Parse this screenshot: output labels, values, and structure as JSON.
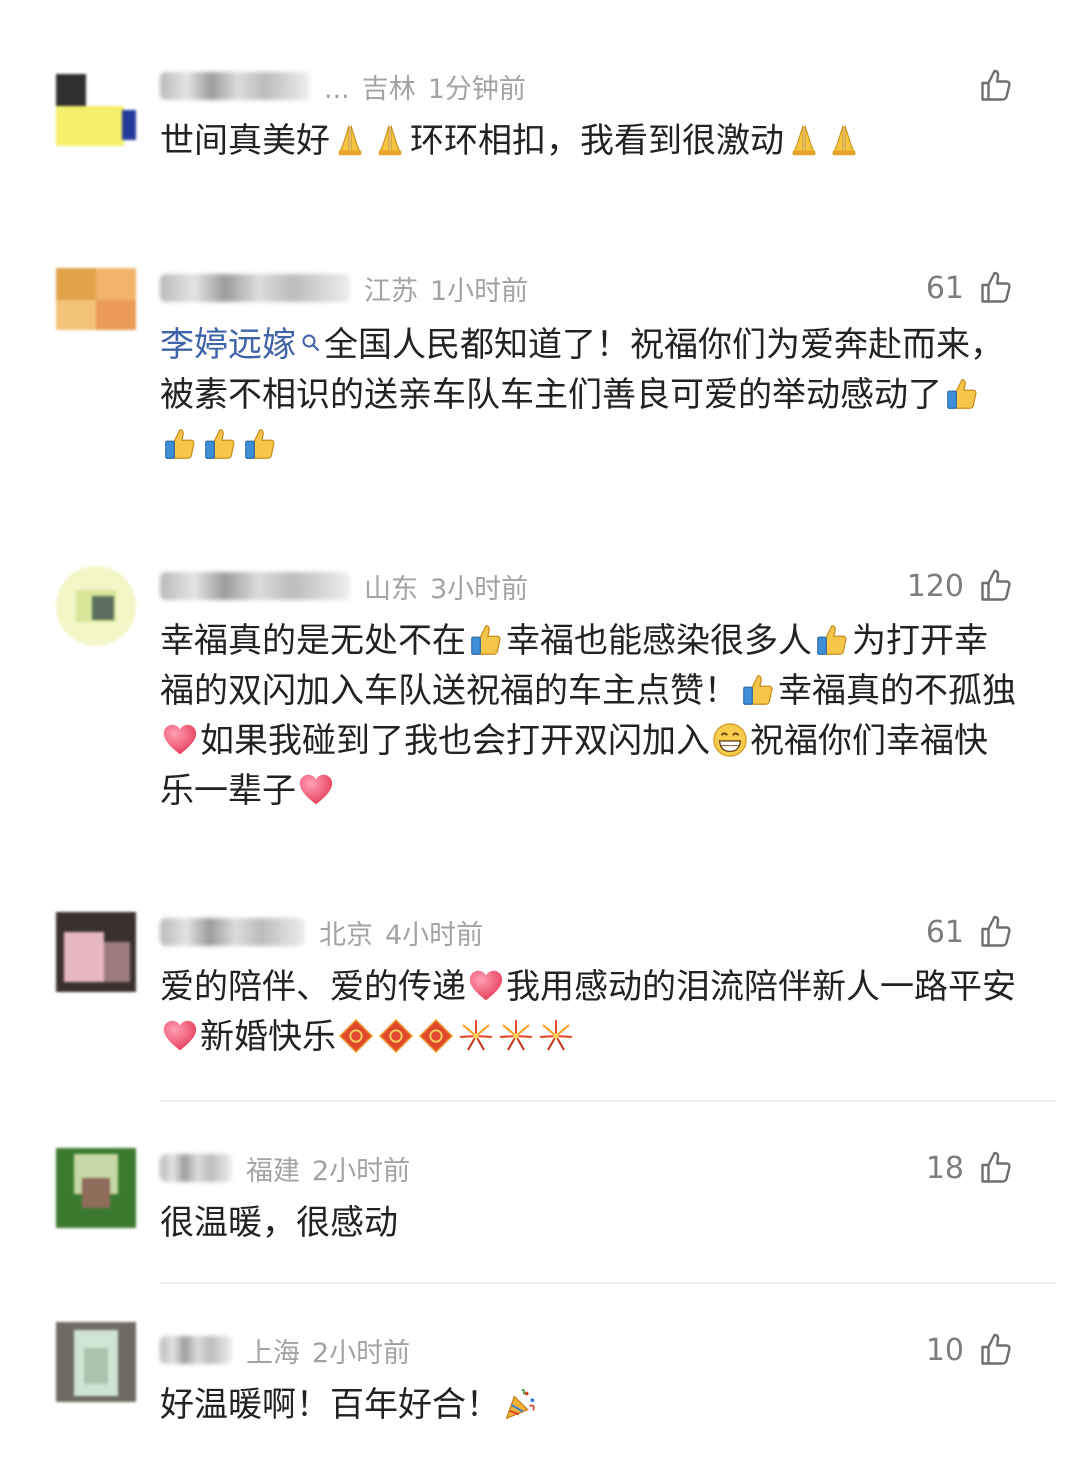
{
  "comments": [
    {
      "location": "吉林",
      "time": "1分钟前",
      "likes": "",
      "name_suffix": "...",
      "parts": [
        {
          "t": "世间真美好"
        },
        {
          "e": "pray"
        },
        {
          "e": "pray"
        },
        {
          "t": "环环相扣，我看到很激动"
        },
        {
          "e": "pray"
        },
        {
          "e": "pray"
        }
      ]
    },
    {
      "location": "江苏",
      "time": "1小时前",
      "likes": "61",
      "parts": [
        {
          "topic": "李婷远嫁"
        },
        {
          "t": "全国人民都知道了！祝福你们为爱奔赴而来，被素不相识的送亲车队车主们善良可爱的举动感动了"
        },
        {
          "e": "thumbsup"
        },
        {
          "e": "thumbsup"
        },
        {
          "e": "thumbsup"
        },
        {
          "e": "thumbsup"
        }
      ]
    },
    {
      "location": "山东",
      "time": "3小时前",
      "likes": "120",
      "parts": [
        {
          "t": "幸福真的是无处不在"
        },
        {
          "e": "thumbsup"
        },
        {
          "t": "幸福也能感染很多人"
        },
        {
          "e": "thumbsup"
        },
        {
          "t": "为打开幸福的双闪加入车队送祝福的车主点赞！"
        },
        {
          "e": "thumbsup"
        },
        {
          "t": "幸福真的不孤独"
        },
        {
          "e": "heart"
        },
        {
          "t": "如果我碰到了我也会打开双闪加入"
        },
        {
          "e": "grin"
        },
        {
          "t": "祝福你们幸福快乐一辈子"
        },
        {
          "e": "heart"
        }
      ]
    },
    {
      "location": "北京",
      "time": "4小时前",
      "likes": "61",
      "parts": [
        {
          "t": "爱的陪伴、爱的传递"
        },
        {
          "e": "heart"
        },
        {
          "t": "我用感动的泪流陪伴新人一路平安"
        },
        {
          "e": "heart"
        },
        {
          "t": "新婚快乐"
        },
        {
          "e": "fu"
        },
        {
          "e": "fu"
        },
        {
          "e": "fu"
        },
        {
          "e": "firework"
        },
        {
          "e": "firework"
        },
        {
          "e": "firework"
        }
      ]
    },
    {
      "location": "福建",
      "time": "2小时前",
      "likes": "18",
      "parts": [
        {
          "t": "很温暖，很感动"
        }
      ]
    },
    {
      "location": "上海",
      "time": "2小时前",
      "likes": "10",
      "parts": [
        {
          "t": "好温暖啊！百年好合！"
        },
        {
          "e": "party"
        }
      ]
    }
  ],
  "icons": {
    "like": "thumb-up-outline-icon",
    "topic": "search-icon"
  },
  "colors": {
    "topic": "#3f63a8",
    "meta": "#a3a3a3",
    "text": "#222222",
    "like_count": "#7d7d7d"
  }
}
